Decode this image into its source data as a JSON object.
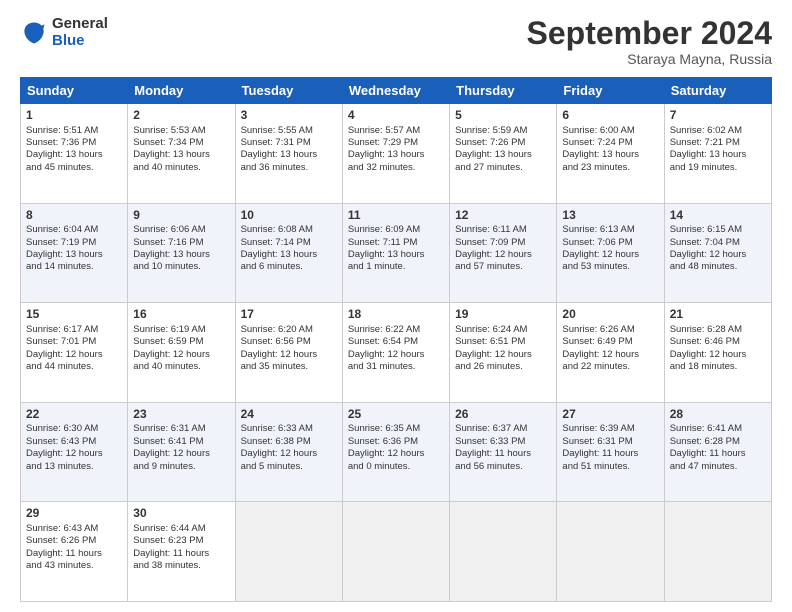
{
  "header": {
    "logo_general": "General",
    "logo_blue": "Blue",
    "month_title": "September 2024",
    "location": "Staraya Mayna, Russia"
  },
  "days_of_week": [
    "Sunday",
    "Monday",
    "Tuesday",
    "Wednesday",
    "Thursday",
    "Friday",
    "Saturday"
  ],
  "weeks": [
    {
      "shade": "white",
      "days": [
        {
          "num": "1",
          "lines": [
            "Sunrise: 5:51 AM",
            "Sunset: 7:36 PM",
            "Daylight: 13 hours",
            "and 45 minutes."
          ]
        },
        {
          "num": "2",
          "lines": [
            "Sunrise: 5:53 AM",
            "Sunset: 7:34 PM",
            "Daylight: 13 hours",
            "and 40 minutes."
          ]
        },
        {
          "num": "3",
          "lines": [
            "Sunrise: 5:55 AM",
            "Sunset: 7:31 PM",
            "Daylight: 13 hours",
            "and 36 minutes."
          ]
        },
        {
          "num": "4",
          "lines": [
            "Sunrise: 5:57 AM",
            "Sunset: 7:29 PM",
            "Daylight: 13 hours",
            "and 32 minutes."
          ]
        },
        {
          "num": "5",
          "lines": [
            "Sunrise: 5:59 AM",
            "Sunset: 7:26 PM",
            "Daylight: 13 hours",
            "and 27 minutes."
          ]
        },
        {
          "num": "6",
          "lines": [
            "Sunrise: 6:00 AM",
            "Sunset: 7:24 PM",
            "Daylight: 13 hours",
            "and 23 minutes."
          ]
        },
        {
          "num": "7",
          "lines": [
            "Sunrise: 6:02 AM",
            "Sunset: 7:21 PM",
            "Daylight: 13 hours",
            "and 19 minutes."
          ]
        }
      ]
    },
    {
      "shade": "shaded",
      "days": [
        {
          "num": "8",
          "lines": [
            "Sunrise: 6:04 AM",
            "Sunset: 7:19 PM",
            "Daylight: 13 hours",
            "and 14 minutes."
          ]
        },
        {
          "num": "9",
          "lines": [
            "Sunrise: 6:06 AM",
            "Sunset: 7:16 PM",
            "Daylight: 13 hours",
            "and 10 minutes."
          ]
        },
        {
          "num": "10",
          "lines": [
            "Sunrise: 6:08 AM",
            "Sunset: 7:14 PM",
            "Daylight: 13 hours",
            "and 6 minutes."
          ]
        },
        {
          "num": "11",
          "lines": [
            "Sunrise: 6:09 AM",
            "Sunset: 7:11 PM",
            "Daylight: 13 hours",
            "and 1 minute."
          ]
        },
        {
          "num": "12",
          "lines": [
            "Sunrise: 6:11 AM",
            "Sunset: 7:09 PM",
            "Daylight: 12 hours",
            "and 57 minutes."
          ]
        },
        {
          "num": "13",
          "lines": [
            "Sunrise: 6:13 AM",
            "Sunset: 7:06 PM",
            "Daylight: 12 hours",
            "and 53 minutes."
          ]
        },
        {
          "num": "14",
          "lines": [
            "Sunrise: 6:15 AM",
            "Sunset: 7:04 PM",
            "Daylight: 12 hours",
            "and 48 minutes."
          ]
        }
      ]
    },
    {
      "shade": "white",
      "days": [
        {
          "num": "15",
          "lines": [
            "Sunrise: 6:17 AM",
            "Sunset: 7:01 PM",
            "Daylight: 12 hours",
            "and 44 minutes."
          ]
        },
        {
          "num": "16",
          "lines": [
            "Sunrise: 6:19 AM",
            "Sunset: 6:59 PM",
            "Daylight: 12 hours",
            "and 40 minutes."
          ]
        },
        {
          "num": "17",
          "lines": [
            "Sunrise: 6:20 AM",
            "Sunset: 6:56 PM",
            "Daylight: 12 hours",
            "and 35 minutes."
          ]
        },
        {
          "num": "18",
          "lines": [
            "Sunrise: 6:22 AM",
            "Sunset: 6:54 PM",
            "Daylight: 12 hours",
            "and 31 minutes."
          ]
        },
        {
          "num": "19",
          "lines": [
            "Sunrise: 6:24 AM",
            "Sunset: 6:51 PM",
            "Daylight: 12 hours",
            "and 26 minutes."
          ]
        },
        {
          "num": "20",
          "lines": [
            "Sunrise: 6:26 AM",
            "Sunset: 6:49 PM",
            "Daylight: 12 hours",
            "and 22 minutes."
          ]
        },
        {
          "num": "21",
          "lines": [
            "Sunrise: 6:28 AM",
            "Sunset: 6:46 PM",
            "Daylight: 12 hours",
            "and 18 minutes."
          ]
        }
      ]
    },
    {
      "shade": "shaded",
      "days": [
        {
          "num": "22",
          "lines": [
            "Sunrise: 6:30 AM",
            "Sunset: 6:43 PM",
            "Daylight: 12 hours",
            "and 13 minutes."
          ]
        },
        {
          "num": "23",
          "lines": [
            "Sunrise: 6:31 AM",
            "Sunset: 6:41 PM",
            "Daylight: 12 hours",
            "and 9 minutes."
          ]
        },
        {
          "num": "24",
          "lines": [
            "Sunrise: 6:33 AM",
            "Sunset: 6:38 PM",
            "Daylight: 12 hours",
            "and 5 minutes."
          ]
        },
        {
          "num": "25",
          "lines": [
            "Sunrise: 6:35 AM",
            "Sunset: 6:36 PM",
            "Daylight: 12 hours",
            "and 0 minutes."
          ]
        },
        {
          "num": "26",
          "lines": [
            "Sunrise: 6:37 AM",
            "Sunset: 6:33 PM",
            "Daylight: 11 hours",
            "and 56 minutes."
          ]
        },
        {
          "num": "27",
          "lines": [
            "Sunrise: 6:39 AM",
            "Sunset: 6:31 PM",
            "Daylight: 11 hours",
            "and 51 minutes."
          ]
        },
        {
          "num": "28",
          "lines": [
            "Sunrise: 6:41 AM",
            "Sunset: 6:28 PM",
            "Daylight: 11 hours",
            "and 47 minutes."
          ]
        }
      ]
    },
    {
      "shade": "white",
      "days": [
        {
          "num": "29",
          "lines": [
            "Sunrise: 6:43 AM",
            "Sunset: 6:26 PM",
            "Daylight: 11 hours",
            "and 43 minutes."
          ]
        },
        {
          "num": "30",
          "lines": [
            "Sunrise: 6:44 AM",
            "Sunset: 6:23 PM",
            "Daylight: 11 hours",
            "and 38 minutes."
          ]
        },
        null,
        null,
        null,
        null,
        null
      ]
    }
  ]
}
